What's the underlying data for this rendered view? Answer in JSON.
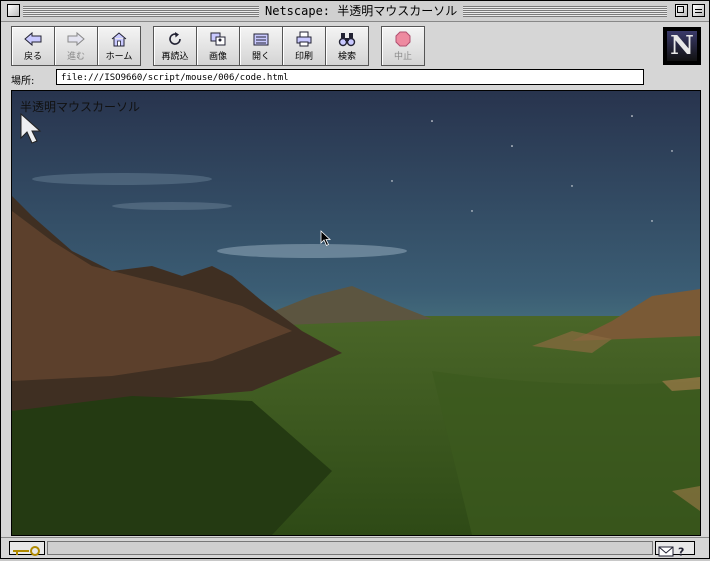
{
  "window": {
    "title": "Netscape: 半透明マウスカーソル"
  },
  "toolbar": {
    "back_label": "戻る",
    "forward_label": "進む",
    "home_label": "ホーム",
    "reload_label": "再読込",
    "images_label": "画像",
    "open_label": "開く",
    "print_label": "印刷",
    "find_label": "検索",
    "stop_label": "中止",
    "logo_letter": "N"
  },
  "location": {
    "label": "場所:",
    "url": "file:///ISO9660/script/mouse/006/code.html"
  },
  "page": {
    "heading": "半透明マウスカーソル",
    "background_image": "mountain-valley-landscape-at-dusk"
  },
  "colors": {
    "window_bg": "#d6d6d6",
    "sky_top": "#2d3c5a",
    "grass": "#3c5a22"
  },
  "icons": {
    "back": "left-arrow-icon",
    "forward": "right-arrow-icon",
    "home": "house-icon",
    "reload": "reload-icon",
    "images": "images-icon",
    "open": "open-icon",
    "print": "printer-icon",
    "find": "binoculars-icon",
    "stop": "stop-icon",
    "status_security": "security-key-icon",
    "status_mail": "mail-icon",
    "status_help": "help-icon"
  }
}
